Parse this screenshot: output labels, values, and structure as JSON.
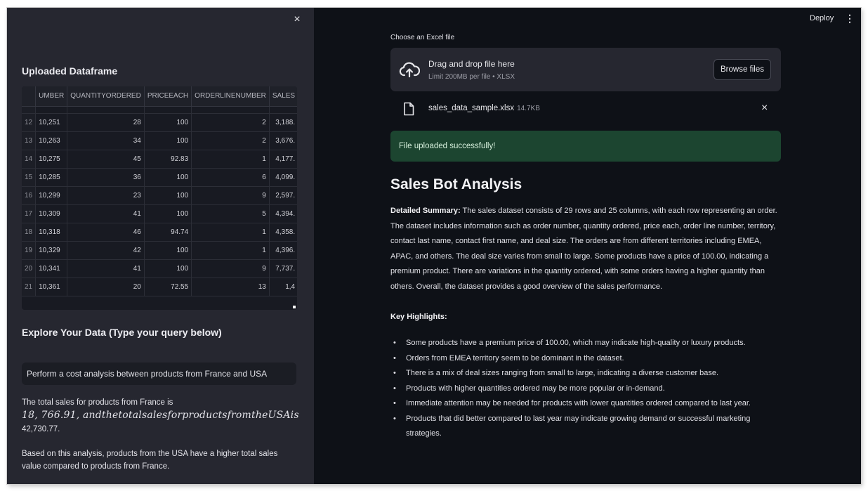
{
  "sidebar": {
    "close_label": "×",
    "uploaded_heading": "Uploaded Dataframe",
    "explore_heading": "Explore Your Data (Type your query below)",
    "query_value": "Perform a cost analysis between products from France and USA",
    "answer": {
      "line1": "The total sales for products from France is",
      "line2": "18, 766.91, andthetotalsalesforproductsfromtheUSAis",
      "line3": "42,730.77.",
      "line4": "Based on this analysis, products from the USA have a higher total sales value compared to products from France."
    }
  },
  "table": {
    "columns": [
      "",
      "UMBER",
      "QUANTITYORDERED",
      "PRICEEACH",
      "ORDERLINENUMBER",
      "SALES"
    ],
    "rows": [
      [
        "12",
        "10,251",
        "28",
        "100",
        "2",
        "3,188."
      ],
      [
        "13",
        "10,263",
        "34",
        "100",
        "2",
        "3,676."
      ],
      [
        "14",
        "10,275",
        "45",
        "92.83",
        "1",
        "4,177."
      ],
      [
        "15",
        "10,285",
        "36",
        "100",
        "6",
        "4,099."
      ],
      [
        "16",
        "10,299",
        "23",
        "100",
        "9",
        "2,597."
      ],
      [
        "17",
        "10,309",
        "41",
        "100",
        "5",
        "4,394."
      ],
      [
        "18",
        "10,318",
        "46",
        "94.74",
        "1",
        "4,358."
      ],
      [
        "19",
        "10,329",
        "42",
        "100",
        "1",
        "4,396."
      ],
      [
        "20",
        "10,341",
        "41",
        "100",
        "9",
        "7,737."
      ],
      [
        "21",
        "10,361",
        "20",
        "72.55",
        "13",
        "1,4"
      ]
    ]
  },
  "header": {
    "deploy_label": "Deploy",
    "menu_label": "⋮"
  },
  "uploader": {
    "label": "Choose an Excel file",
    "drop_text": "Drag and drop file here",
    "limit_text": "Limit 200MB per file • XLSX",
    "browse_label": "Browse files",
    "file_name": "sales_data_sample.xlsx",
    "file_size": "14.7KB",
    "remove_label": "×",
    "success_text": "File uploaded successfully!"
  },
  "analysis": {
    "title": "Sales Bot Analysis",
    "summary_label": "Detailed Summary:",
    "summary_text": " The sales dataset consists of 29 rows and 25 columns, with each row representing an order. The dataset includes information such as order number, quantity ordered, price each, order line number, territory, contact last name, contact first name, and deal size. The orders are from different territories including EMEA, APAC, and others. The deal size varies from small to large. Some products have a price of 100.00, indicating a premium product. There are variations in the quantity ordered, with some orders having a higher quantity than others. Overall, the dataset provides a good overview of the sales performance.",
    "highlights_heading": "Key Highlights:",
    "highlights": [
      "Some products have a premium price of 100.00, which may indicate high-quality or luxury products.",
      "Orders from EMEA territory seem to be dominant in the dataset.",
      "There is a mix of deal sizes ranging from small to large, indicating a diverse customer base.",
      "Products with higher quantities ordered may be more popular or in-demand.",
      "Immediate attention may be needed for products with lower quantities ordered compared to last year.",
      "Products that did better compared to last year may indicate growing demand or successful marketing strategies."
    ]
  },
  "colors": {
    "app_bg": "#0e1117",
    "sidebar_bg": "#262730",
    "success_bg": "#1c4530"
  }
}
